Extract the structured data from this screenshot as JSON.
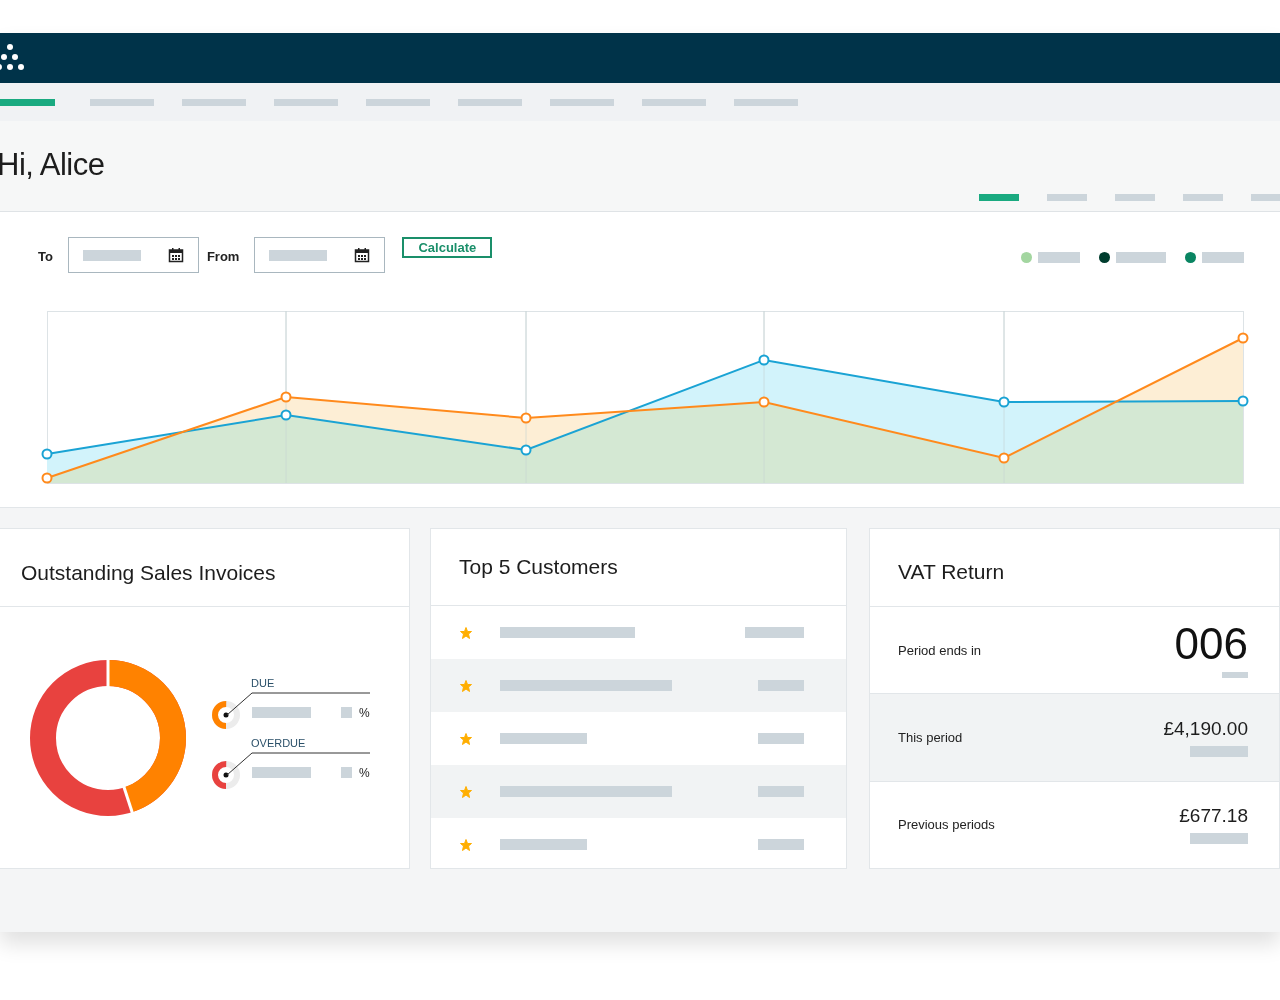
{
  "nav": {
    "items": [
      {
        "selected": true
      },
      {
        "selected": false
      },
      {
        "selected": false
      },
      {
        "selected": false
      },
      {
        "selected": false
      },
      {
        "selected": false
      },
      {
        "selected": false
      },
      {
        "selected": false
      },
      {
        "selected": false
      }
    ]
  },
  "greeting": "Hi, Alice",
  "subtabs": [
    {
      "selected": true
    },
    {
      "selected": false
    },
    {
      "selected": false
    },
    {
      "selected": false
    },
    {
      "selected": false
    }
  ],
  "filters": {
    "to_label": "To",
    "from_label": "From",
    "button": "Calculate"
  },
  "legend": [
    {
      "color": "#a3d6a0"
    },
    {
      "color": "#003d2e"
    },
    {
      "color": "#0a8562"
    }
  ],
  "invoices": {
    "title": "Outstanding Sales Invoices",
    "gauges": [
      {
        "label": "DUE",
        "unit": "%",
        "color": "#ff8200"
      },
      {
        "label": "OVERDUE",
        "unit": "%",
        "color": "#e8423f"
      }
    ]
  },
  "customers": {
    "title": "Top 5 Customers",
    "rows": [
      {
        "starred": true
      },
      {
        "starred": true
      },
      {
        "starred": true
      },
      {
        "starred": true
      },
      {
        "starred": true
      }
    ]
  },
  "vat": {
    "title": "VAT Return",
    "rows": [
      {
        "kind": "big",
        "label": "Period ends in",
        "value": "006"
      },
      {
        "kind": "amount",
        "label": "This period",
        "value": "£4,190.00"
      },
      {
        "kind": "amount",
        "label": "Previous periods",
        "value": "£677.18"
      }
    ]
  }
}
